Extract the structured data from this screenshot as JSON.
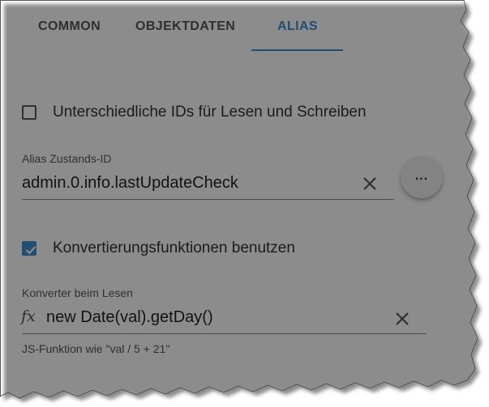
{
  "tabs": [
    {
      "label": "COMMON",
      "active": false
    },
    {
      "label": "OBJEKTDATEN",
      "active": false
    },
    {
      "label": "ALIAS",
      "active": true
    }
  ],
  "different_ids": {
    "label": "Unterschiedliche IDs für Lesen und Schreiben",
    "checked": false
  },
  "alias_id": {
    "label": "Alias Zustands-ID",
    "value": "admin.0.info.lastUpdateCheck",
    "clear_icon": "close-icon",
    "more_label": "..."
  },
  "conversion": {
    "label": "Konvertierungsfunktionen benutzen",
    "checked": true
  },
  "read_converter": {
    "label": "Konverter beim Lesen",
    "prefix_icon": "fx",
    "value": "new Date(val).getDay()",
    "clear_icon": "close-icon",
    "helper": "JS-Funktion wie \"val / 5 + 21\""
  },
  "colors": {
    "accent": "#3a8fd0",
    "text": "#333333",
    "muted": "#5a5a5a"
  }
}
